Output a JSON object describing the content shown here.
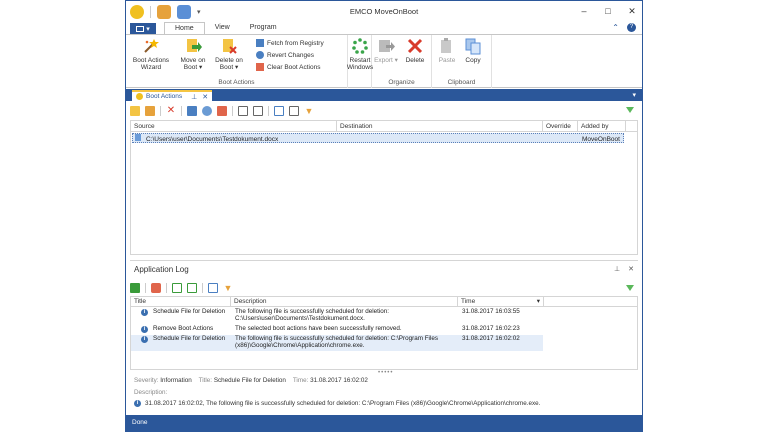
{
  "window": {
    "title": "EMCO MoveOnBoot",
    "minimize": "–",
    "maximize": "□",
    "close": "✕"
  },
  "ribbon_tabs": {
    "file_arrow": "▾",
    "tabs": [
      "Home",
      "View",
      "Program"
    ],
    "collapse": "⌃",
    "help": "?"
  },
  "ribbon": {
    "boot_actions_wizard": "Boot Actions Wizard",
    "move_on_boot": "Move on Boot ▾",
    "delete_on_boot": "Delete on Boot ▾",
    "fetch_from_registry": "Fetch from Registry",
    "revert_changes": "Revert Changes",
    "clear_boot_actions": "Clear Boot Actions",
    "boot_actions_group": "Boot Actions",
    "restart_windows": "Restart Windows",
    "export": "Export ▾",
    "delete": "Delete",
    "organize_group": "Organize",
    "paste": "Paste",
    "copy": "Copy",
    "clipboard_group": "Clipboard"
  },
  "doc_tab": {
    "label": "Boot Actions",
    "pin": "⊥",
    "close": "✕",
    "menu_arrow": "▾"
  },
  "boot_grid": {
    "columns": [
      "Source",
      "Destination",
      "Override",
      "Added by"
    ],
    "rows": [
      {
        "source": "C:\\Users\\user\\Documents\\Testdokument.docx",
        "destination": "",
        "override": "",
        "added_by": "MoveOnBoot"
      }
    ]
  },
  "app_log": {
    "title": "Application Log",
    "pin": "⊥",
    "close": "✕",
    "columns": [
      "Title",
      "Description",
      "Time"
    ],
    "time_sort": "▾",
    "rows": [
      {
        "title": "Schedule File for Deletion",
        "description": "The following file is successfully scheduled for deletion: C:\\Users\\user\\Documents\\Testdokument.docx.",
        "time": "31.08.2017 16:03:55"
      },
      {
        "title": "Remove Boot Actions",
        "description": "The selected boot actions have been successfully removed.",
        "time": "31.08.2017 16:02:23"
      },
      {
        "title": "Schedule File for Deletion",
        "description": "The following file is successfully scheduled for deletion: C:\\Program Files (x86)\\Google\\Chrome\\Application\\chrome.exe.",
        "time": "31.08.2017 16:02:02"
      }
    ],
    "splitter": "•••••",
    "details": {
      "severity_label": "Severity:",
      "severity": "Information",
      "title_label": "Title:",
      "title": "Schedule File for Deletion",
      "time_label": "Time:",
      "time": "31.08.2017 16:02:02",
      "description_label": "Description:",
      "description": "31.08.2017 16:02:02,  The following file is successfully scheduled for deletion: C:\\Program Files (x86)\\Google\\Chrome\\Application\\chrome.exe."
    }
  },
  "status": {
    "text": "Done"
  },
  "icons": {
    "info": "i"
  },
  "colors": {
    "accent": "#2b579a",
    "selection": "#dce8f7",
    "filter_green": "#5bb85b"
  }
}
